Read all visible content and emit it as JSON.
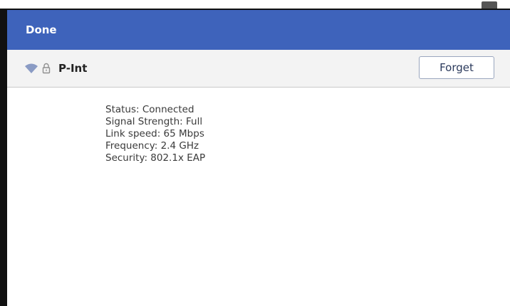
{
  "header": {
    "done_label": "Done",
    "color": "#3e63bb"
  },
  "network": {
    "name": "P-Int",
    "icons": [
      "wifi-icon",
      "lock-icon"
    ],
    "forget_label": "Forget"
  },
  "details": {
    "status": "Status: Connected",
    "signal_strength": "Signal Strength: Full",
    "link_speed": "Link speed: 65 Mbps",
    "frequency": "Frequency: 2.4 GHz",
    "security": "Security: 802.1x EAP"
  }
}
